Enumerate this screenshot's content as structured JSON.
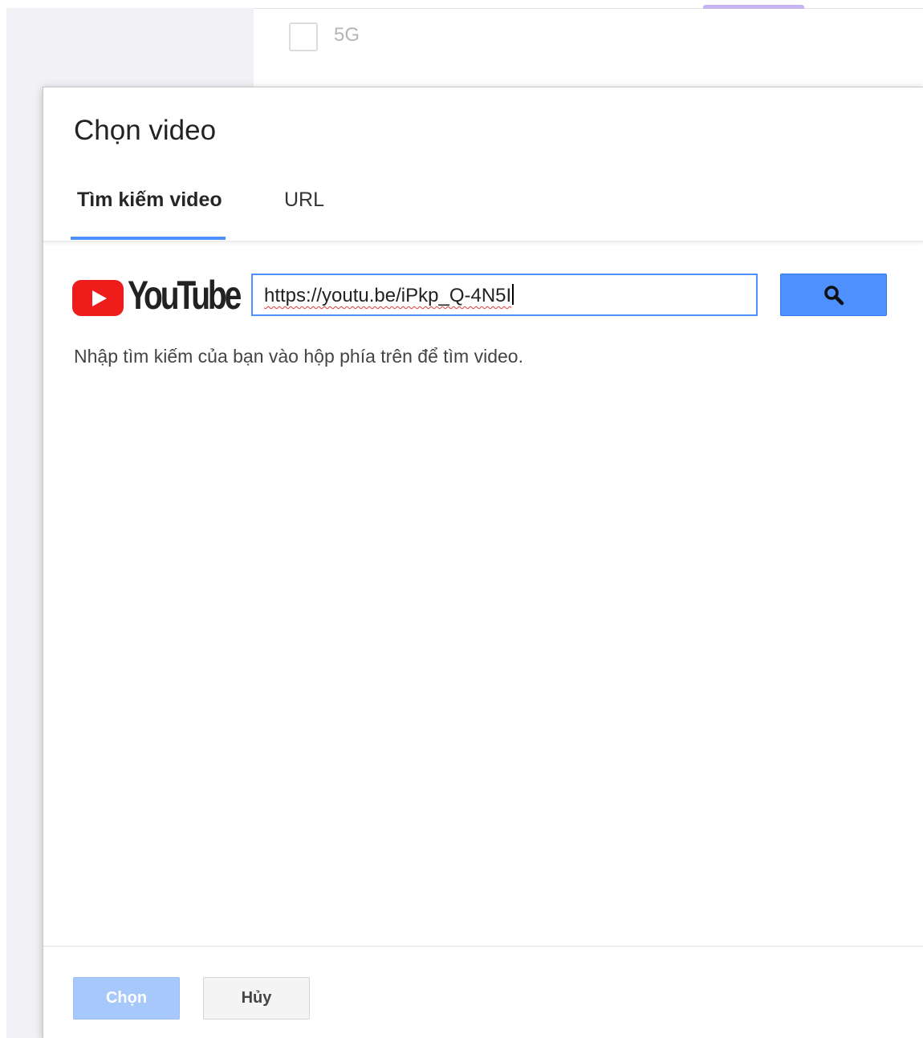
{
  "background": {
    "option_label": "5G"
  },
  "dialog": {
    "title": "Chọn video",
    "tabs": [
      {
        "label": "Tìm kiếm video",
        "active": true
      },
      {
        "label": "URL",
        "active": false
      }
    ],
    "provider_logo": "YouTube",
    "search": {
      "value": "https://youtu.be/iPkp_Q-4N5I",
      "button_icon": "search-icon"
    },
    "hint": "Nhập tìm kiếm của bạn vào hộp phía trên để tìm video.",
    "buttons": {
      "select": "Chọn",
      "cancel": "Hủy"
    }
  },
  "colors": {
    "accent": "#4d90fe",
    "youtube_red": "#ee1c1b",
    "select_disabled": "#a6c8fb",
    "background_accent": "#c5b4ef"
  }
}
